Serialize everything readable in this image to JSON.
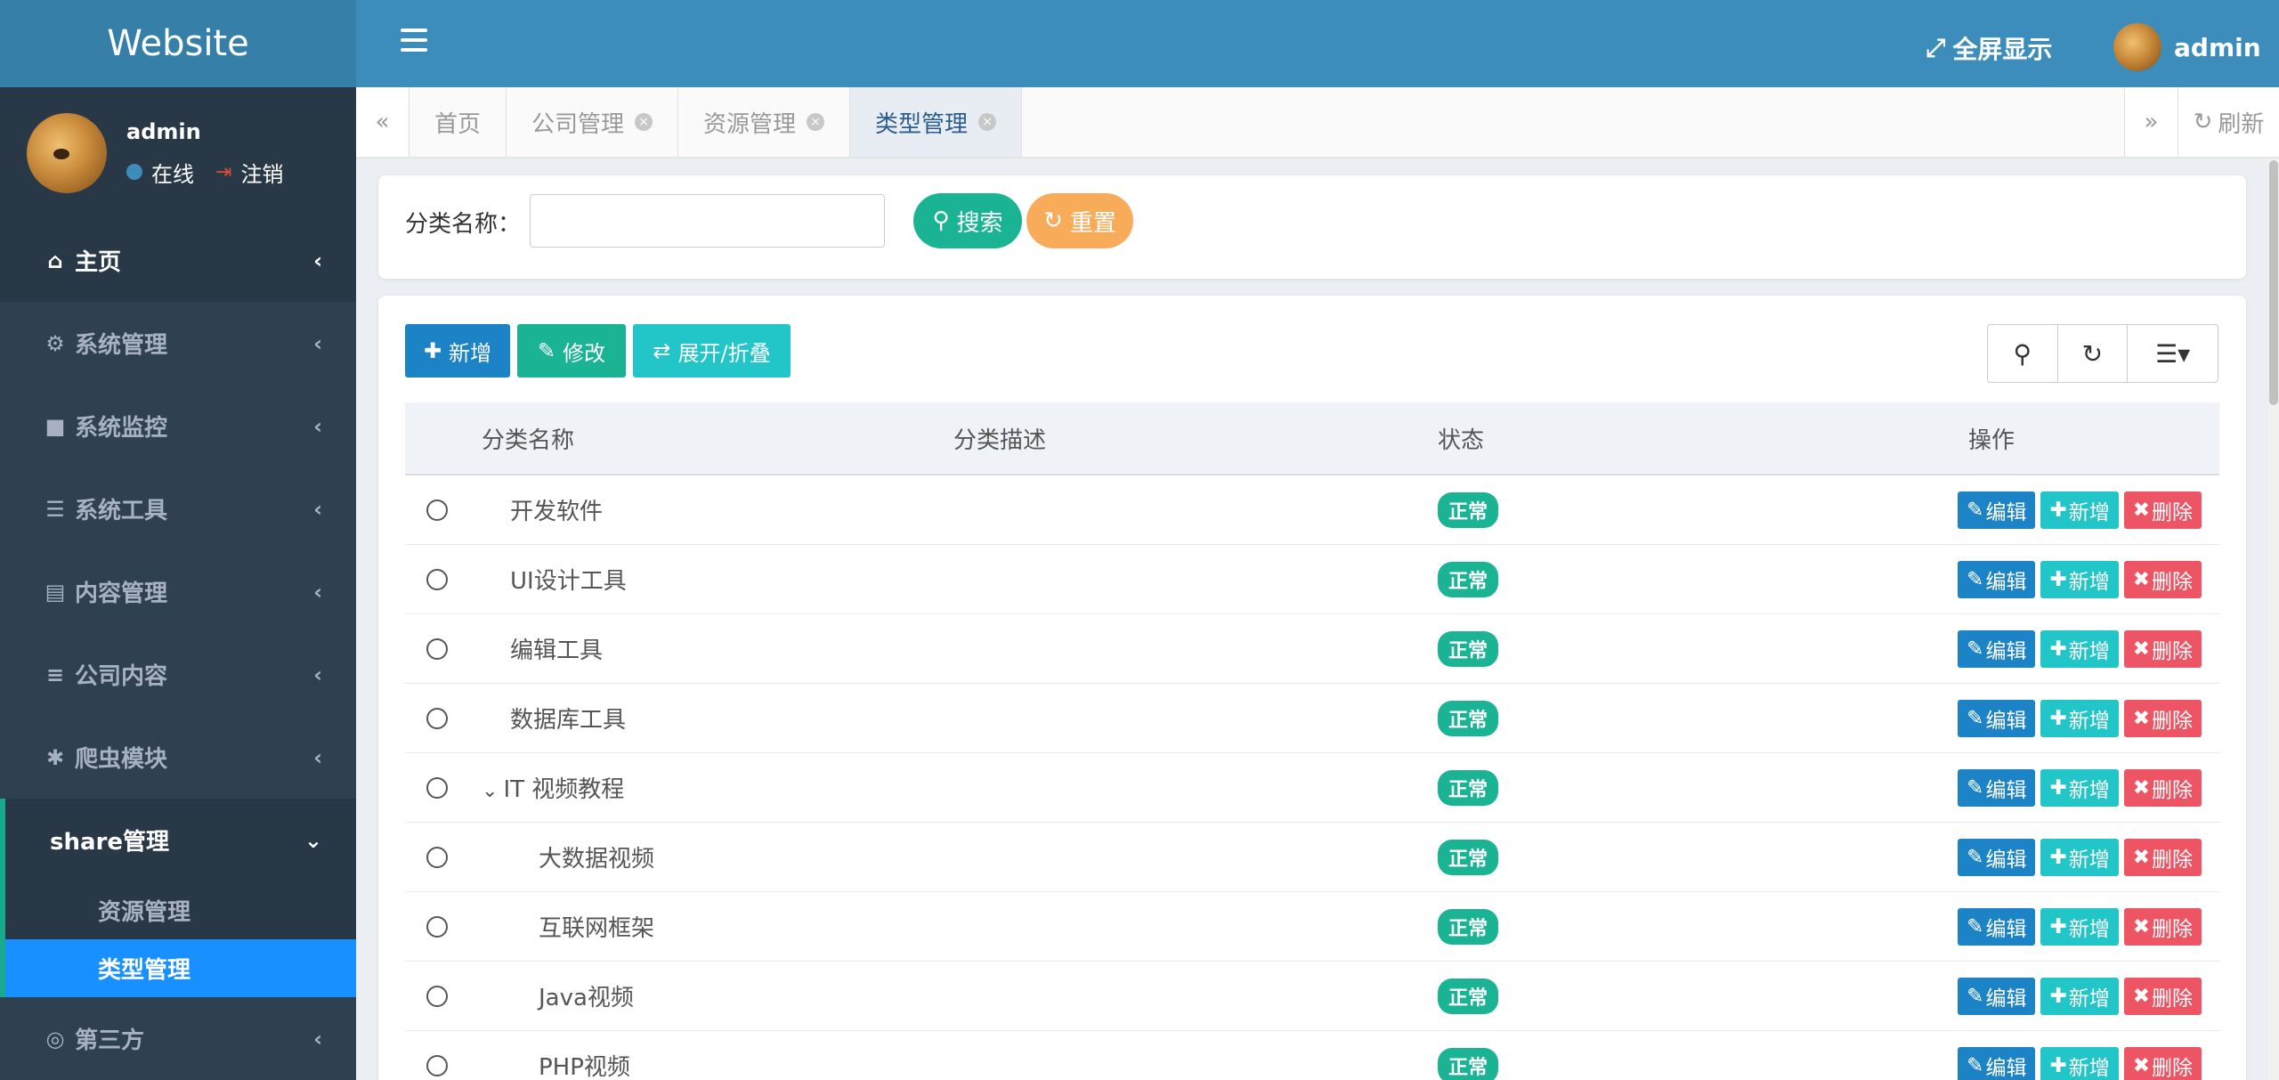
{
  "brand": "Website",
  "user": {
    "name": "admin",
    "status": "在线",
    "logout": "注销"
  },
  "menu": [
    {
      "label": "主页",
      "icon": "home-icon",
      "glyph": "⌂"
    },
    {
      "label": "系统管理",
      "icon": "gear-icon",
      "glyph": "⚙"
    },
    {
      "label": "系统监控",
      "icon": "video-camera-icon",
      "glyph": "■"
    },
    {
      "label": "系统工具",
      "icon": "bars-icon",
      "glyph": "☰"
    },
    {
      "label": "内容管理",
      "icon": "id-card-icon",
      "glyph": "▤"
    },
    {
      "label": "公司内容",
      "icon": "server-icon",
      "glyph": "≡"
    },
    {
      "label": "爬虫模块",
      "icon": "bug-icon",
      "glyph": "✱"
    },
    {
      "label": "share管理",
      "icon": "",
      "glyph": ""
    },
    {
      "label": "第三方",
      "icon": "life-ring-icon",
      "glyph": "◎"
    }
  ],
  "submenu": [
    "资源管理",
    "类型管理"
  ],
  "topbar": {
    "fullscreen": "全屏显示",
    "user": "admin"
  },
  "tabs": [
    {
      "label": "首页",
      "closable": false
    },
    {
      "label": "公司管理",
      "closable": true
    },
    {
      "label": "资源管理",
      "closable": true
    },
    {
      "label": "类型管理",
      "closable": true
    }
  ],
  "refresh": "刷新",
  "search": {
    "label": "分类名称：",
    "value": "",
    "search_btn": "搜索",
    "reset_btn": "重置"
  },
  "toolbar": {
    "add": "新增",
    "edit": "修改",
    "toggle": "展开/折叠"
  },
  "table": {
    "columns": [
      "分类名称",
      "分类描述",
      "状态",
      "操作"
    ],
    "rows": [
      {
        "name": "开发软件",
        "desc": "",
        "status": "正常",
        "level": 0,
        "parent": false
      },
      {
        "name": "UI设计工具",
        "desc": "",
        "status": "正常",
        "level": 0,
        "parent": false
      },
      {
        "name": "编辑工具",
        "desc": "",
        "status": "正常",
        "level": 0,
        "parent": false
      },
      {
        "name": "数据库工具",
        "desc": "",
        "status": "正常",
        "level": 0,
        "parent": false
      },
      {
        "name": "IT 视频教程",
        "desc": "",
        "status": "正常",
        "level": 0,
        "parent": true
      },
      {
        "name": "大数据视频",
        "desc": "",
        "status": "正常",
        "level": 1,
        "parent": false
      },
      {
        "name": "互联网框架",
        "desc": "",
        "status": "正常",
        "level": 1,
        "parent": false
      },
      {
        "name": "Java视频",
        "desc": "",
        "status": "正常",
        "level": 1,
        "parent": false
      },
      {
        "name": "PHP视频",
        "desc": "",
        "status": "正常",
        "level": 1,
        "parent": false
      }
    ],
    "ops": {
      "edit": "编辑",
      "add": "新增",
      "delete": "删除"
    }
  },
  "colors": {
    "sidebar": "#2f4050",
    "topbar": "#3c8dbc",
    "brand": "#367fa9",
    "primary": "#1c84c6",
    "success": "#1ab394",
    "info": "#23c6c8",
    "danger": "#ed5565",
    "warning": "#f8ac59",
    "active_sub": "#1890ff"
  }
}
